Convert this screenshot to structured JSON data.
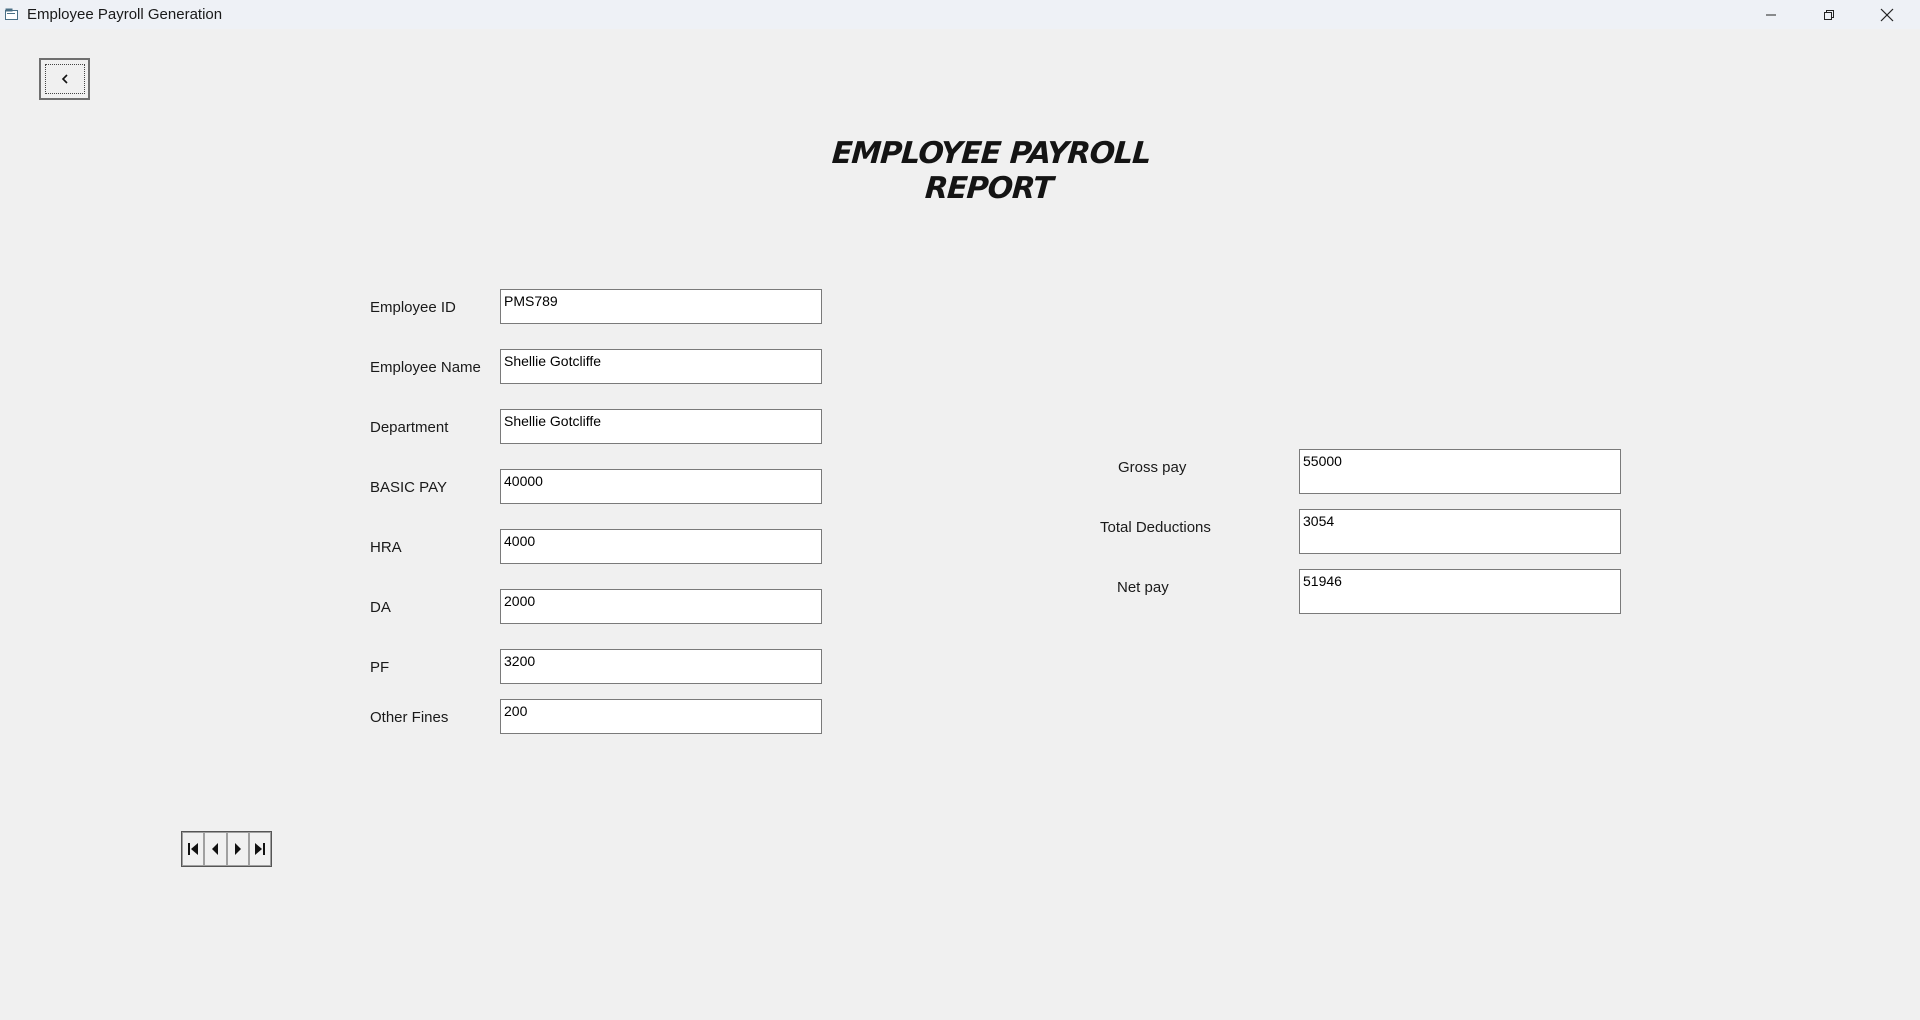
{
  "window": {
    "title": "Employee Payroll Generation"
  },
  "header": {
    "back_symbol": "<",
    "report_title": "EMPLOYEE PAYROLL REPORT"
  },
  "form_left": [
    {
      "label": "Employee ID",
      "value": "PMS789"
    },
    {
      "label": "Employee Name",
      "value": "Shellie Gotcliffe"
    },
    {
      "label": "Department",
      "value": "Shellie Gotcliffe"
    },
    {
      "label": "BASIC PAY",
      "value": "40000"
    },
    {
      "label": "HRA",
      "value": "4000"
    },
    {
      "label": "DA",
      "value": "2000"
    },
    {
      "label": "PF",
      "value": "3200"
    },
    {
      "label": "Other Fines",
      "value": "200"
    }
  ],
  "form_right": [
    {
      "label": "Gross pay",
      "value": "55000"
    },
    {
      "label": "Total Deductions",
      "value": "3054"
    },
    {
      "label": "Net pay",
      "value": "51946"
    }
  ],
  "navigator": {
    "buttons": [
      "first-record-icon",
      "previous-record-icon",
      "next-record-icon",
      "last-record-icon"
    ]
  },
  "colors": {
    "background": "#f0f0f0",
    "titlebar": "#eef1f6",
    "field_border": "#7a7a7a"
  }
}
